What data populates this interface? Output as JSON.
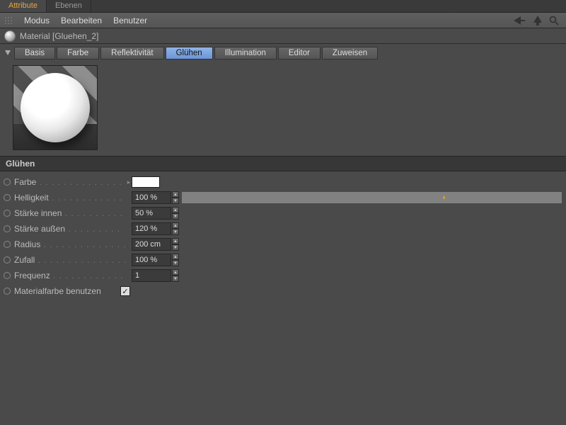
{
  "tabs": {
    "attribute": "Attribute",
    "layers": "Ebenen"
  },
  "menu": {
    "mode": "Modus",
    "edit": "Bearbeiten",
    "user": "Benutzer"
  },
  "material": {
    "label": "Material [Gluehen_2]"
  },
  "channels": {
    "basis": "Basis",
    "farbe": "Farbe",
    "reflekt": "Reflektivität",
    "gluehen": "Glühen",
    "illum": "Illumination",
    "editor": "Editor",
    "zuweisen": "Zuweisen"
  },
  "section": {
    "title": "Glühen"
  },
  "props": {
    "farbe": {
      "label": "Farbe",
      "color": "#ffffff"
    },
    "hellig": {
      "label": "Helligkeit",
      "value": "100 %"
    },
    "innen": {
      "label": "Stärke innen",
      "value": "50 %"
    },
    "aussen": {
      "label": "Stärke außen",
      "value": "120 %"
    },
    "radius": {
      "label": "Radius",
      "value": "200 cm"
    },
    "zufall": {
      "label": "Zufall",
      "value": "100 %"
    },
    "freq": {
      "label": "Frequenz",
      "value": "1"
    },
    "matfarbe": {
      "label": "Materialfarbe benutzen",
      "checked": true
    }
  }
}
